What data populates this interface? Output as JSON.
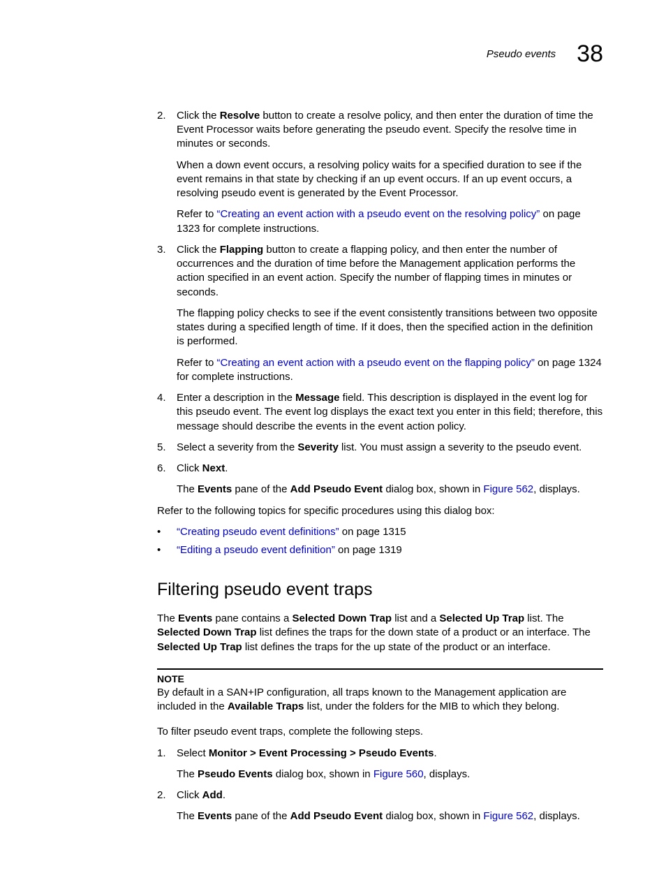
{
  "header": {
    "title": "Pseudo events",
    "chapter": "38"
  },
  "steps_a": [
    {
      "num": "2.",
      "p1_a": "Click the ",
      "p1_bold1": "Resolve",
      "p1_b": " button to create a resolve policy, and then enter the duration of time the Event Processor waits before generating the pseudo event. Specify the resolve time in minutes or seconds.",
      "p2": "When a down event occurs, a resolving policy waits for a specified duration to see if the event remains in that state by checking if an up event occurs. If an up event occurs, a resolving pseudo event is generated by the Event Processor.",
      "p3_a": "Refer to ",
      "p3_link": "“Creating an event action with a pseudo event on the  resolving policy”",
      "p3_b": " on page 1323 for complete instructions."
    },
    {
      "num": "3.",
      "p1_a": "Click the ",
      "p1_bold1": "Flapping",
      "p1_b": " button to create a flapping policy, and then enter the number of occurrences and the duration of time before the Management application performs the action specified in an event action. Specify the number of flapping times in minutes or seconds.",
      "p2": "The flapping policy checks to see if the event consistently transitions between two opposite states during a specified length of time. If it does, then the specified action in the definition is performed.",
      "p3_a": "Refer to ",
      "p3_link": "“Creating an event action with a pseudo event on the  flapping policy”",
      "p3_b": " on page 1324 for complete instructions."
    },
    {
      "num": "4.",
      "p1_a": "Enter a description in the ",
      "p1_bold1": "Message",
      "p1_b": " field. This description is displayed in the event log for this pseudo event. The event log displays the exact text you enter in this field; therefore, this message should describe the events in the event action policy."
    },
    {
      "num": "5.",
      "p1_a": "Select a severity from the ",
      "p1_bold1": "Severity",
      "p1_b": " list. You must assign a severity to the pseudo event."
    },
    {
      "num": "6.",
      "p1_a": "Click ",
      "p1_bold1": "Next",
      "p1_b": ".",
      "p2_a": "The ",
      "p2_bold1": "Events",
      "p2_b": " pane of the ",
      "p2_bold2": "Add Pseudo Event",
      "p2_c": " dialog box, shown in ",
      "p2_link": "Figure 562",
      "p2_d": ", displays."
    }
  ],
  "refer": "Refer to the following topics for specific procedures using this dialog box:",
  "bullets": [
    {
      "link": "“Creating pseudo event definitions”",
      "tail": " on page 1315"
    },
    {
      "link": "“Editing a pseudo event definition”",
      "tail": " on page 1319"
    }
  ],
  "section_heading": "Filtering pseudo event traps",
  "section_p1": {
    "a": "The ",
    "b1": "Events",
    "b": " pane contains a ",
    "b2": "Selected Down Trap",
    "c": " list and a ",
    "b3": "Selected Up Trap",
    "d": " list. The ",
    "b4": "Selected Down Trap",
    "e": " list defines the traps for the down state of a product or an interface. The ",
    "b5": "Selected Up Trap",
    "f": " list defines the traps for the up state of the product or an interface."
  },
  "note": {
    "label": "NOTE",
    "a": "By default in a SAN+IP configuration, all traps known to the Management application are included in the ",
    "b1": "Available Traps",
    "b": " list, under the folders for the MIB to which they belong."
  },
  "filter_intro": "To filter pseudo event traps, complete the following steps.",
  "steps_b": [
    {
      "num": "1.",
      "p1_a": "Select ",
      "p1_bold1": "Monitor > Event Processing > Pseudo Events",
      "p1_b": ".",
      "p2_a": "The ",
      "p2_bold1": "Pseudo Events",
      "p2_b": " dialog box, shown in ",
      "p2_link": "Figure 560",
      "p2_c": ", displays."
    },
    {
      "num": "2.",
      "p1_a": "Click ",
      "p1_bold1": "Add",
      "p1_b": ".",
      "p2_a": "The ",
      "p2_bold1": "Events",
      "p2_b": " pane of the ",
      "p2_bold2": "Add Pseudo Event",
      "p2_c": " dialog box, shown in ",
      "p2_link": "Figure 562",
      "p2_d": ", displays."
    }
  ]
}
